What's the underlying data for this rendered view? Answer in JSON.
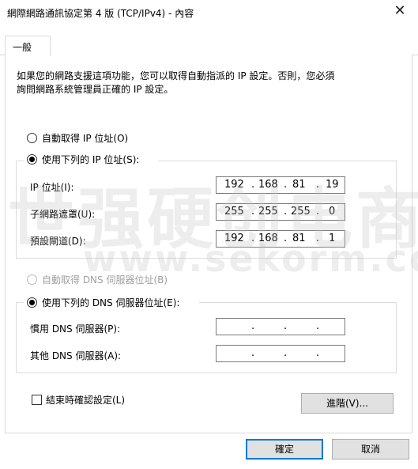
{
  "window": {
    "title": "網際網路通訊協定第 4 版 (TCP/IPv4) - 內容",
    "close_glyph": "✕"
  },
  "tabs": [
    {
      "label": "一般"
    }
  ],
  "description": "如果您的網路支援這項功能，您可以取得自動指派的 IP 設定。否則，您必須\n詢問網路系統管理員正確的 IP 設定。",
  "ip": {
    "auto_label": "自動取得 IP 位址(O)",
    "manual_label": "使用下列的 IP 位址(S):",
    "selected": "manual",
    "fields": [
      {
        "label": "IP 位址(I):",
        "octets": [
          "192",
          "168",
          "81",
          "19"
        ]
      },
      {
        "label": "子網路遮罩(U):",
        "octets": [
          "255",
          "255",
          "255",
          "0"
        ]
      },
      {
        "label": "預設閘道(D):",
        "octets": [
          "192",
          "168",
          "81",
          "1"
        ]
      }
    ]
  },
  "dns": {
    "auto_label": "自動取得 DNS 伺服器位址(B)",
    "manual_label": "使用下列的 DNS 伺服器位址(E):",
    "selected": "manual",
    "fields": [
      {
        "label": "慣用 DNS 伺服器(P):",
        "octets": [
          "",
          "",
          "",
          ""
        ]
      },
      {
        "label": "其他 DNS 伺服器(A):",
        "octets": [
          "",
          "",
          "",
          ""
        ]
      }
    ]
  },
  "validate_checkbox": {
    "label": "結束時確認設定(L)",
    "checked": false
  },
  "buttons": {
    "advanced": "進階(V)...",
    "ok": "確定",
    "cancel": "取消"
  },
  "watermark": {
    "line1": "世强硬创电商",
    "line2": "www.sekorm.com"
  },
  "colors": {
    "default_button_border": "#0078d7",
    "button_bg": "#e1e1e1",
    "border": "#d9d9d9"
  }
}
